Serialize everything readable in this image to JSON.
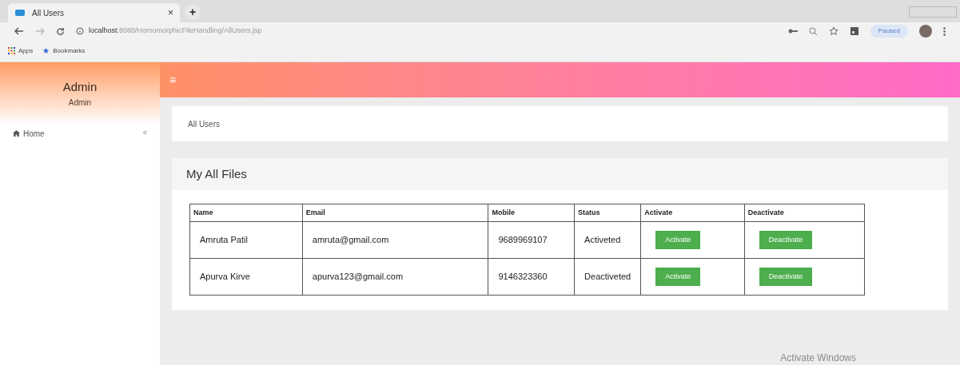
{
  "browser": {
    "tab_title": "All Users",
    "tab_close": "×",
    "new_tab": "+",
    "url_host": "localhost",
    "url_path": ":8080/HomomorphicFileHandling/AllUsers.jsp",
    "profile_status": "Paused",
    "bookmarks": [
      "Apps",
      "Bookmarks"
    ]
  },
  "sidebar": {
    "title": "Admin",
    "subtitle": "Admin",
    "items": [
      {
        "label": "Home",
        "caret": "<",
        "selected": false
      }
    ]
  },
  "header": {
    "menu_glyph": "≡"
  },
  "breadcrumb": "All Users",
  "panel": {
    "title": "My All Files",
    "table": {
      "columns": [
        "Name",
        "Email",
        "Mobile",
        "Status",
        "Activate",
        "Deactivate"
      ],
      "rows": [
        {
          "name": "Amruta Patil",
          "email": "amruta@gmail.com",
          "mobile": "9689969107",
          "status": "Activeted",
          "activate": "Activate",
          "deactivate": "Deactivate"
        },
        {
          "name": "Apurva Kirve",
          "email": "apurva123@gmail.com",
          "mobile": "9146323360",
          "status": "Deactiveted",
          "activate": "Activate",
          "deactivate": "Deactivate"
        }
      ]
    }
  },
  "os_notice": "Activate Windows"
}
